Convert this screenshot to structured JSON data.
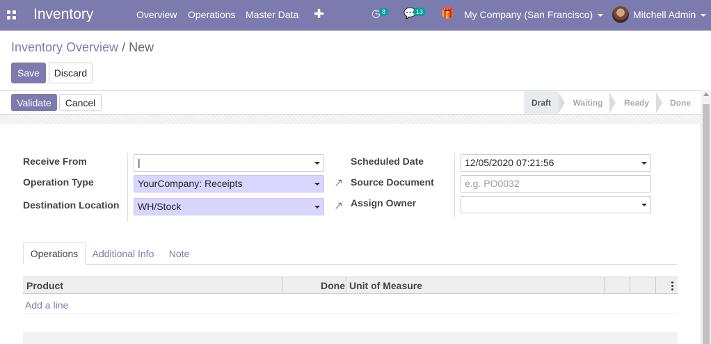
{
  "topbar": {
    "app_title": "Inventory",
    "menu": [
      "Overview",
      "Operations",
      "Master Data"
    ],
    "activity_count": "8",
    "message_count": "13",
    "company": "My Company (San Francisco)",
    "user": "Mitchell Admin",
    "icons": [
      "apps-icon",
      "plus-icon",
      "activity-icon",
      "chat-icon",
      "gift-icon"
    ]
  },
  "breadcrumb": {
    "parent": "Inventory Overview",
    "separator": "/",
    "current": "New"
  },
  "actions": {
    "save": "Save",
    "discard": "Discard",
    "validate": "Validate",
    "cancel": "Cancel"
  },
  "status": {
    "stages": [
      "Draft",
      "Waiting",
      "Ready",
      "Done"
    ],
    "active": "Draft"
  },
  "form": {
    "left": [
      {
        "label": "Receive From",
        "value": "|",
        "kind": "select",
        "highlight": false
      },
      {
        "label": "Operation Type",
        "value": "YourCompany: Receipts",
        "kind": "select",
        "highlight": true
      },
      {
        "label": "Destination Location",
        "value": "WH/Stock",
        "kind": "select",
        "highlight": true
      }
    ],
    "right": [
      {
        "label": "Scheduled Date",
        "value": "12/05/2020 07:21:56",
        "kind": "select"
      },
      {
        "label": "Source Document",
        "value": "",
        "placeholder": "e.g. PO0032",
        "kind": "text"
      },
      {
        "label": "Assign Owner",
        "value": "",
        "kind": "select"
      }
    ]
  },
  "tabs": {
    "items": [
      "Operations",
      "Additional Info",
      "Note"
    ],
    "active": "Operations"
  },
  "table": {
    "columns": [
      "Product",
      "Done",
      "Unit of Measure"
    ],
    "add_line": "Add a line"
  },
  "colors": {
    "primary": "#7c7bad",
    "highlight_field": "#d8d5ff",
    "badge": "#00a09d"
  }
}
